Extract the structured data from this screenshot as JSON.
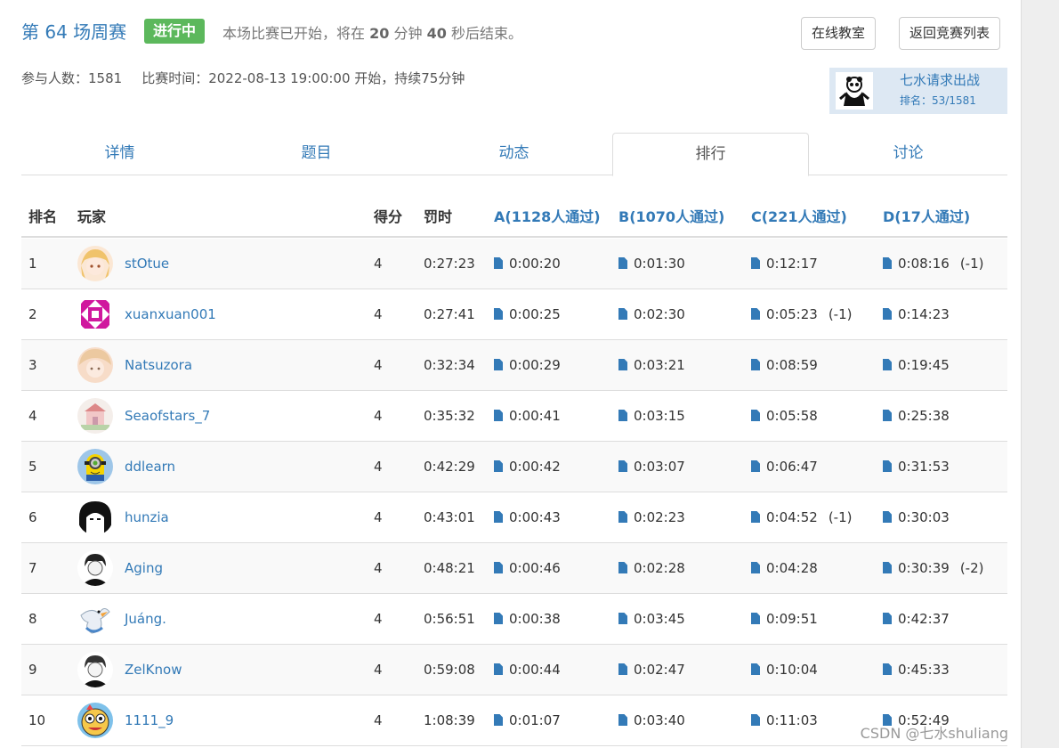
{
  "header": {
    "title": "第 64 场周赛",
    "badge": "进行中",
    "status_prefix": "本场比赛已开始，将在",
    "status_min": "20",
    "status_min_unit": "分钟",
    "status_sec": "40",
    "status_suffix": "秒后结束。",
    "btn_online": "在线教室",
    "btn_back": "返回竞赛列表"
  },
  "meta": {
    "participants": "参与人数：1581",
    "time": "比赛时间：2022-08-13 19:00:00 开始，持续75分钟"
  },
  "me": {
    "name": "七水请求出战",
    "rank": "排名：53/1581"
  },
  "tabs": [
    "详情",
    "题目",
    "动态",
    "排行",
    "讨论"
  ],
  "active_tab": "排行",
  "columns": {
    "rank": "排名",
    "player": "玩家",
    "score": "得分",
    "penalty": "罚时",
    "a": "A(1128人通过)",
    "b": "B(1070人通过)",
    "c": "C(221人通过)",
    "d": "D(17人通过)"
  },
  "rows": [
    {
      "rank": "1",
      "name": "stOtue",
      "score": "4",
      "penalty": "0:27:23",
      "a": "0:00:20",
      "a_pen": "",
      "b": "0:01:30",
      "b_pen": "",
      "c": "0:12:17",
      "c_pen": "",
      "d": "0:08:16",
      "d_pen": "(-1)"
    },
    {
      "rank": "2",
      "name": "xuanxuan001",
      "score": "4",
      "penalty": "0:27:41",
      "a": "0:00:25",
      "a_pen": "",
      "b": "0:02:30",
      "b_pen": "",
      "c": "0:05:23",
      "c_pen": "(-1)",
      "d": "0:14:23",
      "d_pen": ""
    },
    {
      "rank": "3",
      "name": "Natsuzora",
      "score": "4",
      "penalty": "0:32:34",
      "a": "0:00:29",
      "a_pen": "",
      "b": "0:03:21",
      "b_pen": "",
      "c": "0:08:59",
      "c_pen": "",
      "d": "0:19:45",
      "d_pen": ""
    },
    {
      "rank": "4",
      "name": "Seaofstars_7",
      "score": "4",
      "penalty": "0:35:32",
      "a": "0:00:41",
      "a_pen": "",
      "b": "0:03:15",
      "b_pen": "",
      "c": "0:05:58",
      "c_pen": "",
      "d": "0:25:38",
      "d_pen": ""
    },
    {
      "rank": "5",
      "name": "ddlearn",
      "score": "4",
      "penalty": "0:42:29",
      "a": "0:00:42",
      "a_pen": "",
      "b": "0:03:07",
      "b_pen": "",
      "c": "0:06:47",
      "c_pen": "",
      "d": "0:31:53",
      "d_pen": ""
    },
    {
      "rank": "6",
      "name": "hunzia",
      "score": "4",
      "penalty": "0:43:01",
      "a": "0:00:43",
      "a_pen": "",
      "b": "0:02:23",
      "b_pen": "",
      "c": "0:04:52",
      "c_pen": "(-1)",
      "d": "0:30:03",
      "d_pen": ""
    },
    {
      "rank": "7",
      "name": "Aging",
      "score": "4",
      "penalty": "0:48:21",
      "a": "0:00:46",
      "a_pen": "",
      "b": "0:02:28",
      "b_pen": "",
      "c": "0:04:28",
      "c_pen": "",
      "d": "0:30:39",
      "d_pen": "(-2)"
    },
    {
      "rank": "8",
      "name": "Juáng.",
      "score": "4",
      "penalty": "0:56:51",
      "a": "0:00:38",
      "a_pen": "",
      "b": "0:03:45",
      "b_pen": "",
      "c": "0:09:51",
      "c_pen": "",
      "d": "0:42:37",
      "d_pen": ""
    },
    {
      "rank": "9",
      "name": "ZelKnow",
      "score": "4",
      "penalty": "0:59:08",
      "a": "0:00:44",
      "a_pen": "",
      "b": "0:02:47",
      "b_pen": "",
      "c": "0:10:04",
      "c_pen": "",
      "d": "0:45:33",
      "d_pen": ""
    },
    {
      "rank": "10",
      "name": "1111_9",
      "score": "4",
      "penalty": "1:08:39",
      "a": "0:01:07",
      "a_pen": "",
      "b": "0:03:40",
      "b_pen": "",
      "c": "0:11:03",
      "c_pen": "",
      "d": "0:52:49",
      "d_pen": ""
    }
  ],
  "watermark": "CSDN @七水shuliang",
  "colors": {
    "accent": "#337ab7",
    "badge": "#5cb85c",
    "me_bg": "#dde8f3"
  }
}
